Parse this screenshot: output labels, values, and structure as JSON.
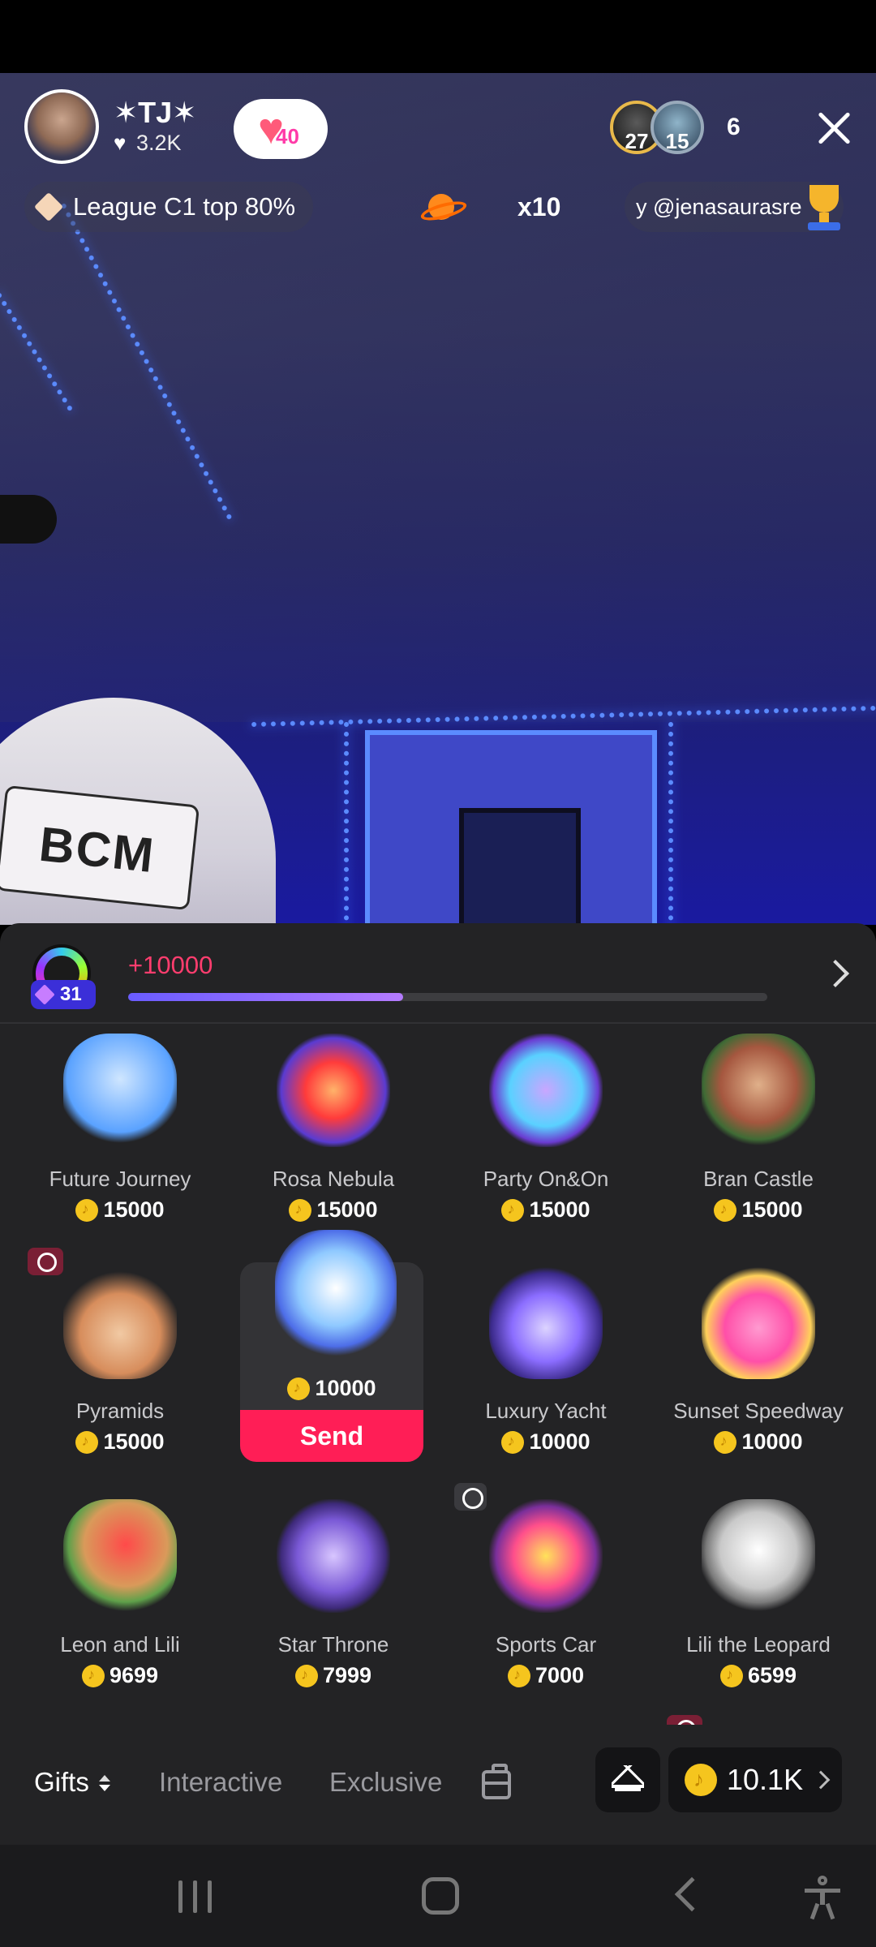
{
  "host": {
    "name": "✶TJ✶",
    "likes": "3.2K",
    "fan_level": "40"
  },
  "viewers": {
    "top_badges": [
      "27",
      "15"
    ],
    "count": "6"
  },
  "league": {
    "label": "League C1 top 80%"
  },
  "boost": {
    "multiplier": "x10"
  },
  "ticker": {
    "text": "y @jenasaurasre"
  },
  "level": {
    "number": "31",
    "delta": "+10000",
    "progress_fraction": 0.43
  },
  "gifts": [
    {
      "name": "Future Journey",
      "price": "15000",
      "thumb": "journey"
    },
    {
      "name": "Rosa Nebula",
      "price": "15000",
      "thumb": "rosa"
    },
    {
      "name": "Party On&On",
      "price": "15000",
      "thumb": "party"
    },
    {
      "name": "Bran Castle",
      "price": "15000",
      "thumb": "castle"
    },
    {
      "name": "Pyramids",
      "price": "15000",
      "thumb": "pyramid"
    },
    {
      "name": "",
      "price": "10000",
      "thumb": "astro",
      "selected": true,
      "send_label": "Send"
    },
    {
      "name": "Luxury Yacht",
      "price": "10000",
      "thumb": "yacht"
    },
    {
      "name": "Sunset Speedway",
      "price": "10000",
      "thumb": "speedway"
    },
    {
      "name": "Leon and Lili",
      "price": "9699",
      "thumb": "leon"
    },
    {
      "name": "Star Throne",
      "price": "7999",
      "thumb": "throne"
    },
    {
      "name": "Sports Car",
      "price": "7000",
      "thumb": "car"
    },
    {
      "name": "Lili the Leopard",
      "price": "6599",
      "thumb": "lili"
    }
  ],
  "tabs": {
    "gifts": "Gifts",
    "interactive": "Interactive",
    "exclusive": "Exclusive"
  },
  "balance": {
    "value": "10.1K"
  },
  "colors": {
    "send_button": "#ff1e56",
    "level_delta": "#ff3d6e",
    "coin": "#f5c51e",
    "panel_bg": "#232325"
  }
}
